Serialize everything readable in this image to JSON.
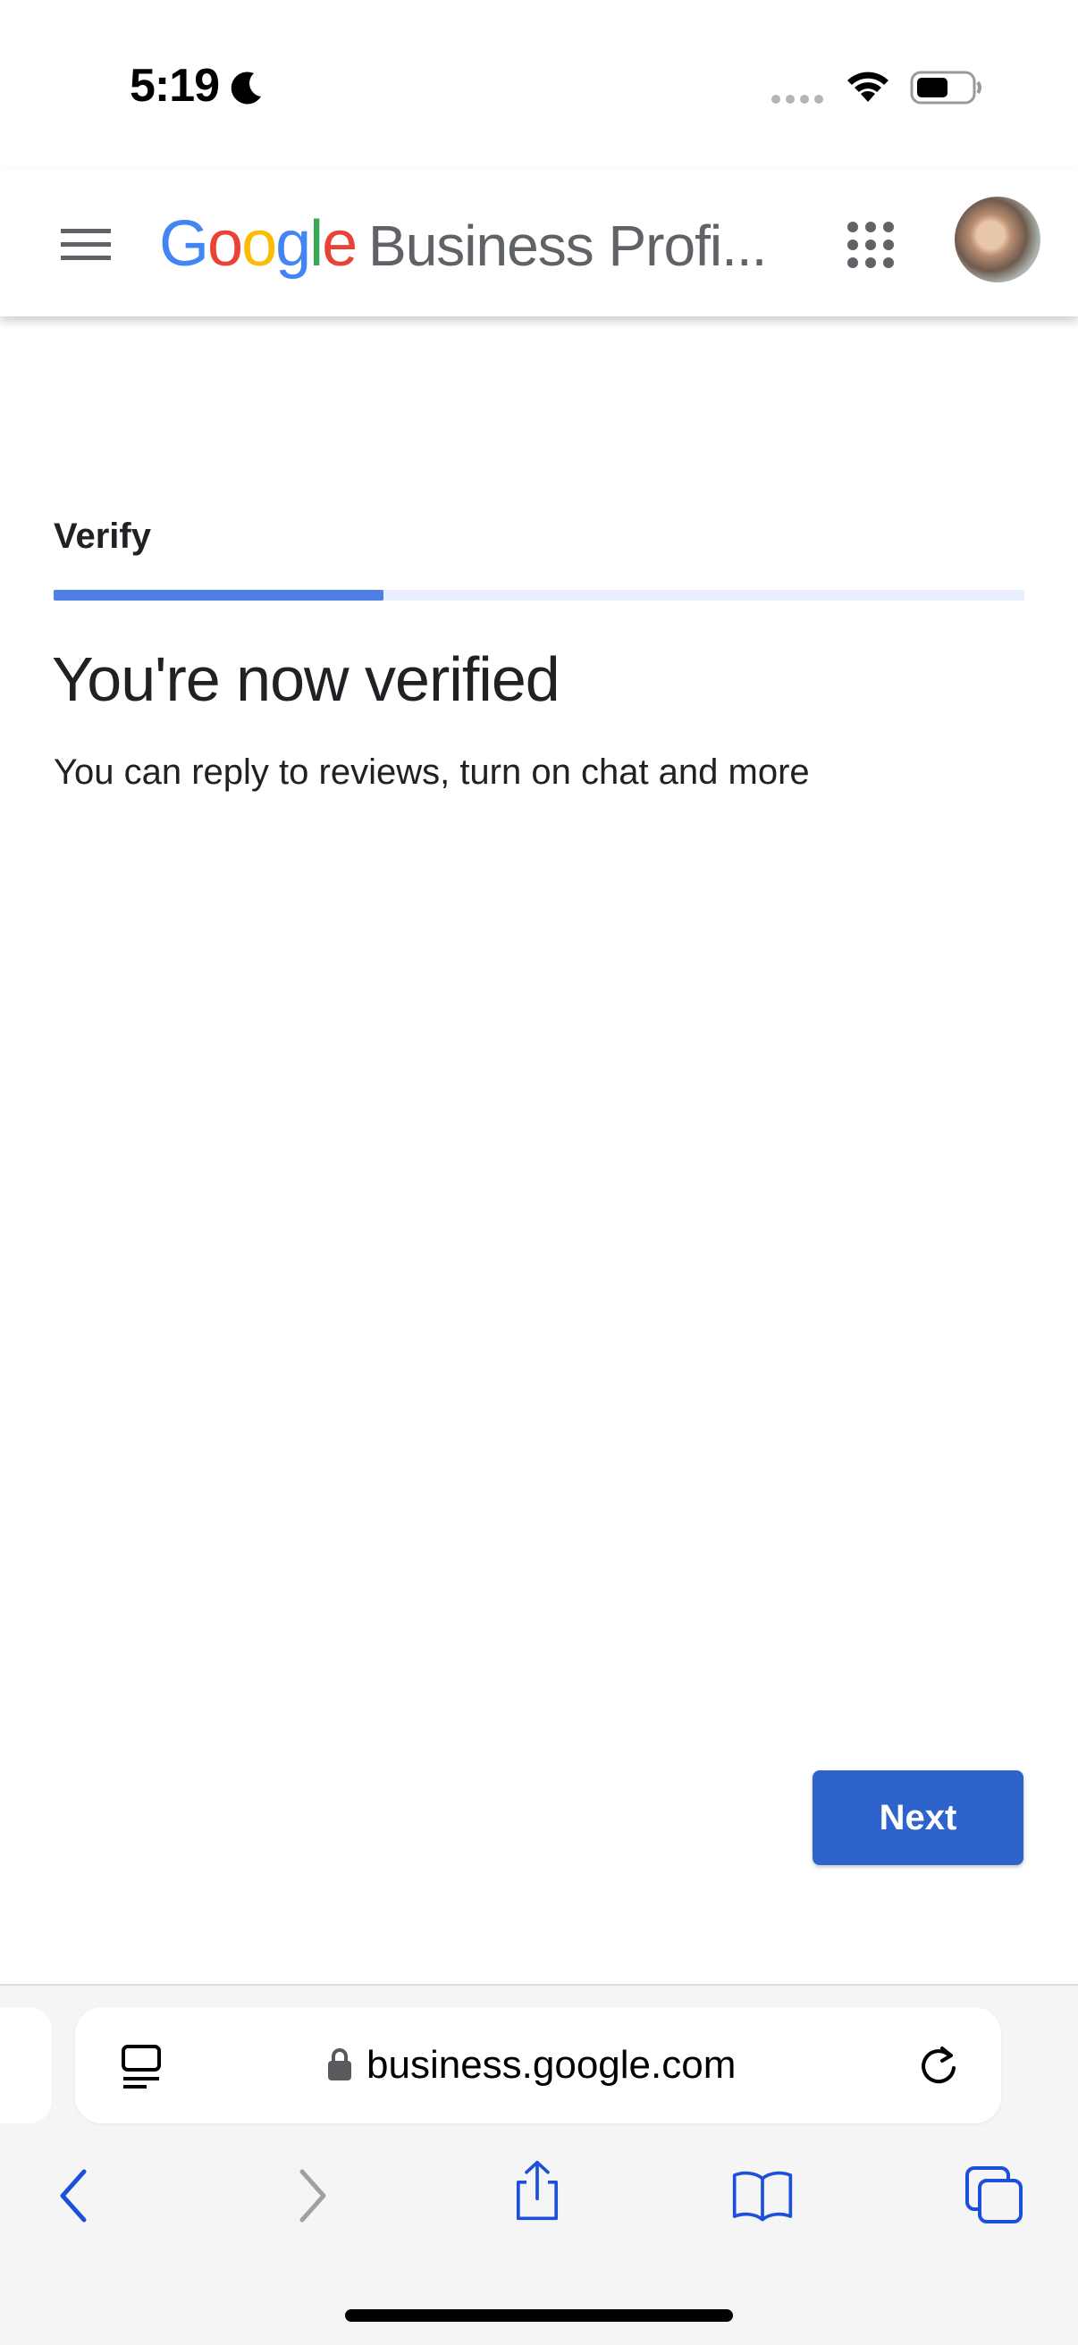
{
  "status_bar": {
    "time": "5:19"
  },
  "app_bar": {
    "logo_letters": [
      {
        "char": "G",
        "color": "#4285F4"
      },
      {
        "char": "o",
        "color": "#EA4335"
      },
      {
        "char": "o",
        "color": "#FBBC05"
      },
      {
        "char": "g",
        "color": "#4285F4"
      },
      {
        "char": "l",
        "color": "#34A853"
      },
      {
        "char": "e",
        "color": "#EA4335"
      }
    ],
    "product_name": "Business Profi..."
  },
  "verify": {
    "step_label": "Verify",
    "progress_fraction": 0.34,
    "heading": "You're now verified",
    "description": "You can reply to reviews, turn on chat and more",
    "next_label": "Next"
  },
  "browser": {
    "url": "business.google.com"
  },
  "colors": {
    "accent": "#2f63cc",
    "progress": "#4f7fe4",
    "toolbar_icon": "#1d4fd8"
  }
}
